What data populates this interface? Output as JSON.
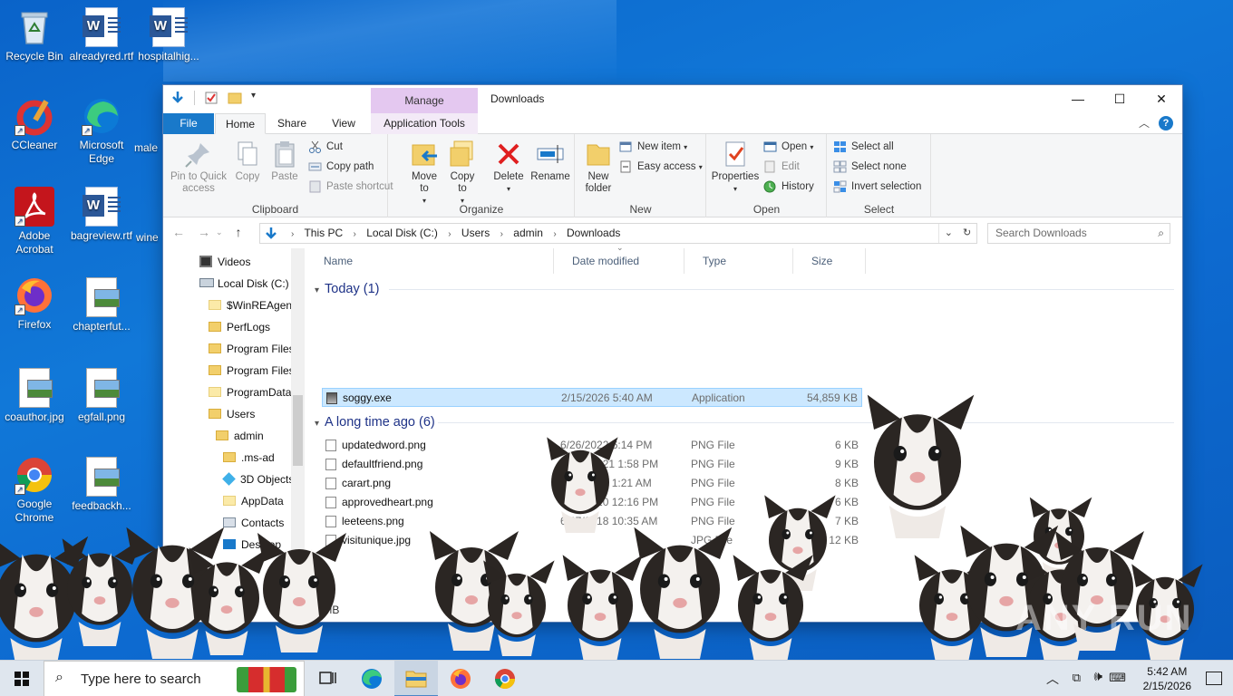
{
  "desktop": {
    "icons": [
      {
        "label": "Recycle Bin"
      },
      {
        "label": "alreadyred.rtf"
      },
      {
        "label": "hospitalhig..."
      },
      {
        "label": "CCleaner"
      },
      {
        "label": "Microsoft Edge"
      },
      {
        "label": "male"
      },
      {
        "label": "Adobe Acrobat"
      },
      {
        "label": "bagreview.rtf"
      },
      {
        "label": "wine"
      },
      {
        "label": "Firefox"
      },
      {
        "label": "chapterfut..."
      },
      {
        "label": "coauthor.jpg"
      },
      {
        "label": "egfall.png"
      },
      {
        "label": "Google Chrome"
      },
      {
        "label": "feedbackh..."
      }
    ],
    "watermark": "ANY RUN"
  },
  "window": {
    "title": "Downloads",
    "manage_tab": "Manage",
    "tabs": [
      "File",
      "Home",
      "Share",
      "View",
      "Application Tools"
    ],
    "controls": {
      "minimize": "—",
      "maximize": "☐",
      "close": "✕"
    }
  },
  "ribbon": {
    "clipboard": {
      "label": "Clipboard",
      "pin": "Pin to Quick access",
      "copy": "Copy",
      "paste": "Paste",
      "cut": "Cut",
      "copy_path": "Copy path",
      "paste_shortcut": "Paste shortcut"
    },
    "organize": {
      "label": "Organize",
      "move_to": "Move to",
      "copy_to": "Copy to",
      "delete": "Delete",
      "rename": "Rename"
    },
    "new": {
      "label": "New",
      "new_folder": "New folder",
      "new_item": "New item",
      "easy_access": "Easy access"
    },
    "open": {
      "label": "Open",
      "properties": "Properties",
      "open": "Open",
      "edit": "Edit",
      "history": "History"
    },
    "select": {
      "label": "Select",
      "select_all": "Select all",
      "select_none": "Select none",
      "invert": "Invert selection"
    }
  },
  "address": {
    "crumbs": [
      "This PC",
      "Local Disk (C:)",
      "Users",
      "admin",
      "Downloads"
    ],
    "search_placeholder": "Search Downloads"
  },
  "navpane": {
    "items": [
      {
        "label": "Videos"
      },
      {
        "label": "Local Disk (C:)"
      },
      {
        "label": "$WinREAgent"
      },
      {
        "label": "PerfLogs"
      },
      {
        "label": "Program Files"
      },
      {
        "label": "Program Files"
      },
      {
        "label": "ProgramData"
      },
      {
        "label": "Users"
      },
      {
        "label": "admin"
      },
      {
        "label": ".ms-ad"
      },
      {
        "label": "3D Objects"
      },
      {
        "label": "AppData"
      },
      {
        "label": "Contacts"
      },
      {
        "label": "Desktop"
      }
    ]
  },
  "columns": [
    "Name",
    "Date modified",
    "Type",
    "Size"
  ],
  "groups": {
    "today": {
      "label": "Today (1)",
      "rows": [
        {
          "name": "soggy.exe",
          "date": "2/15/2026 5:40 AM",
          "type": "Application",
          "size": "54,859 KB"
        }
      ]
    },
    "long_ago": {
      "label": "A long time ago (6)",
      "rows": [
        {
          "name": "updatedword.png",
          "date": "6/26/2022 6:14 PM",
          "type": "PNG File",
          "size": "6 KB"
        },
        {
          "name": "defaultfriend.png",
          "date": "12/26/2021 1:58 PM",
          "type": "PNG File",
          "size": "9 KB"
        },
        {
          "name": "carart.png",
          "date": "3/16/2021 1:21 AM",
          "type": "PNG File",
          "size": "8 KB"
        },
        {
          "name": "approvedheart.png",
          "date": "3/27/2020 12:16 PM",
          "type": "PNG File",
          "size": "6 KB"
        },
        {
          "name": "leeteens.png",
          "date": "6/27/2018 10:35 AM",
          "type": "PNG File",
          "size": "7 KB"
        },
        {
          "name": "visitunique.jpg",
          "date": "",
          "type": "JPG File",
          "size": "12 KB"
        }
      ]
    }
  },
  "statusbar": {
    "text": ".5 MB"
  },
  "taskbar": {
    "search_placeholder": "Type here to search",
    "time": "5:42 AM",
    "date": "2/15/2026"
  }
}
